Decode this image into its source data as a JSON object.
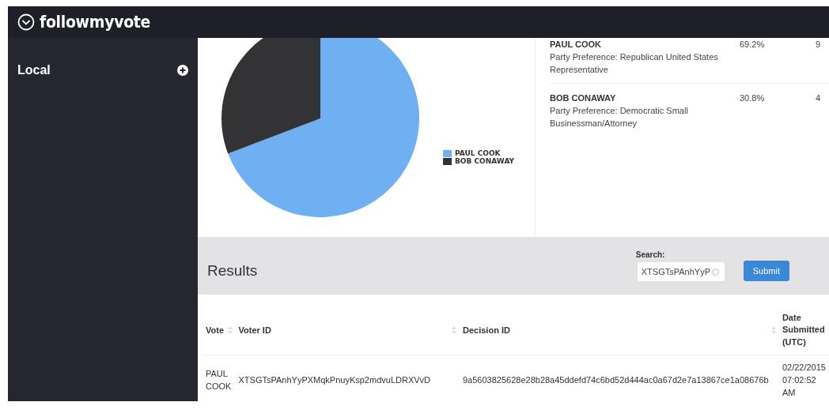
{
  "header": {
    "logo": "followmyvote"
  },
  "sidebar": {
    "items": [
      {
        "label": "Local"
      }
    ]
  },
  "chart": {
    "chart_data": {
      "type": "pie",
      "categories": [
        "PAUL COOK",
        "BOB CONAWAY"
      ],
      "series": [
        {
          "values": [
            69.2,
            30.8
          ]
        }
      ],
      "colors": [
        "#6fb0f3",
        "#333335"
      ]
    }
  },
  "candidates": [
    {
      "name": "PAUL COOK",
      "party": "Party Preference: Republican United States Representative",
      "percent": "69.2%",
      "votes": "9"
    },
    {
      "name": "BOB CONAWAY",
      "party": "Party Preference: Democratic Small Businessman/Attorney",
      "percent": "30.8%",
      "votes": "4"
    }
  ],
  "results": {
    "title": "Results",
    "search_label": "Search:",
    "search_value": "XTSGTsPAnhYyP",
    "submit": "Submit"
  },
  "table": {
    "columns": [
      "Vote",
      "Voter ID",
      "Decision ID",
      "Date Submitted (UTC)"
    ],
    "rows": [
      [
        "PAUL COOK",
        "XTSGTsPAnhYyPXMqkPnuyKsp2mdvuLDRXVvD",
        "9a5603825628e28b28a45ddefd74c6bd52d444ac0a67d2e7a13867ce1a08676b",
        "02/22/2015 07:02:52 AM"
      ]
    ]
  }
}
